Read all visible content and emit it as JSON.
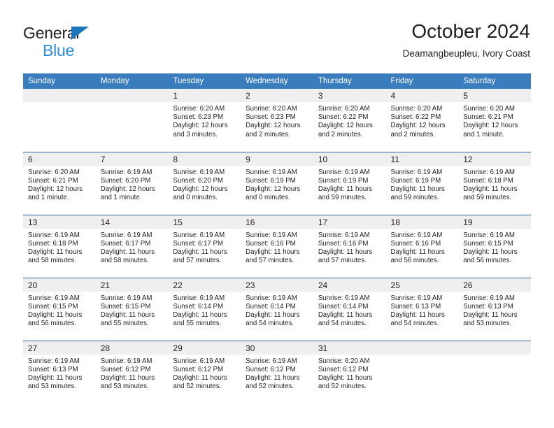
{
  "brand": {
    "name_part1": "General",
    "name_part2": "Blue",
    "colors": {
      "dark": "#231f20",
      "blue": "#2b8ede",
      "triangle": "#1b75bb"
    }
  },
  "header": {
    "title": "October 2024",
    "subtitle": "Deamangbeupleu, Ivory Coast"
  },
  "theme": {
    "header_bg": "#3a7dbf",
    "row_divider": "#2f6aa8",
    "daynum_bg": "#efefef",
    "text": "#231f20"
  },
  "weekdays": [
    "Sunday",
    "Monday",
    "Tuesday",
    "Wednesday",
    "Thursday",
    "Friday",
    "Saturday"
  ],
  "labels": {
    "sunrise": "Sunrise:",
    "sunset": "Sunset:",
    "daylight": "Daylight:"
  },
  "weeks": [
    [
      {
        "day": ""
      },
      {
        "day": ""
      },
      {
        "day": "1",
        "sunrise": "Sunrise: 6:20 AM",
        "sunset": "Sunset: 6:23 PM",
        "daylight_line1": "Daylight: 12 hours",
        "daylight_line2": "and 3 minutes."
      },
      {
        "day": "2",
        "sunrise": "Sunrise: 6:20 AM",
        "sunset": "Sunset: 6:23 PM",
        "daylight_line1": "Daylight: 12 hours",
        "daylight_line2": "and 2 minutes."
      },
      {
        "day": "3",
        "sunrise": "Sunrise: 6:20 AM",
        "sunset": "Sunset: 6:22 PM",
        "daylight_line1": "Daylight: 12 hours",
        "daylight_line2": "and 2 minutes."
      },
      {
        "day": "4",
        "sunrise": "Sunrise: 6:20 AM",
        "sunset": "Sunset: 6:22 PM",
        "daylight_line1": "Daylight: 12 hours",
        "daylight_line2": "and 2 minutes."
      },
      {
        "day": "5",
        "sunrise": "Sunrise: 6:20 AM",
        "sunset": "Sunset: 6:21 PM",
        "daylight_line1": "Daylight: 12 hours",
        "daylight_line2": "and 1 minute."
      }
    ],
    [
      {
        "day": "6",
        "sunrise": "Sunrise: 6:20 AM",
        "sunset": "Sunset: 6:21 PM",
        "daylight_line1": "Daylight: 12 hours",
        "daylight_line2": "and 1 minute."
      },
      {
        "day": "7",
        "sunrise": "Sunrise: 6:19 AM",
        "sunset": "Sunset: 6:20 PM",
        "daylight_line1": "Daylight: 12 hours",
        "daylight_line2": "and 1 minute."
      },
      {
        "day": "8",
        "sunrise": "Sunrise: 6:19 AM",
        "sunset": "Sunset: 6:20 PM",
        "daylight_line1": "Daylight: 12 hours",
        "daylight_line2": "and 0 minutes."
      },
      {
        "day": "9",
        "sunrise": "Sunrise: 6:19 AM",
        "sunset": "Sunset: 6:19 PM",
        "daylight_line1": "Daylight: 12 hours",
        "daylight_line2": "and 0 minutes."
      },
      {
        "day": "10",
        "sunrise": "Sunrise: 6:19 AM",
        "sunset": "Sunset: 6:19 PM",
        "daylight_line1": "Daylight: 11 hours",
        "daylight_line2": "and 59 minutes."
      },
      {
        "day": "11",
        "sunrise": "Sunrise: 6:19 AM",
        "sunset": "Sunset: 6:19 PM",
        "daylight_line1": "Daylight: 11 hours",
        "daylight_line2": "and 59 minutes."
      },
      {
        "day": "12",
        "sunrise": "Sunrise: 6:19 AM",
        "sunset": "Sunset: 6:18 PM",
        "daylight_line1": "Daylight: 11 hours",
        "daylight_line2": "and 59 minutes."
      }
    ],
    [
      {
        "day": "13",
        "sunrise": "Sunrise: 6:19 AM",
        "sunset": "Sunset: 6:18 PM",
        "daylight_line1": "Daylight: 11 hours",
        "daylight_line2": "and 58 minutes."
      },
      {
        "day": "14",
        "sunrise": "Sunrise: 6:19 AM",
        "sunset": "Sunset: 6:17 PM",
        "daylight_line1": "Daylight: 11 hours",
        "daylight_line2": "and 58 minutes."
      },
      {
        "day": "15",
        "sunrise": "Sunrise: 6:19 AM",
        "sunset": "Sunset: 6:17 PM",
        "daylight_line1": "Daylight: 11 hours",
        "daylight_line2": "and 57 minutes."
      },
      {
        "day": "16",
        "sunrise": "Sunrise: 6:19 AM",
        "sunset": "Sunset: 6:16 PM",
        "daylight_line1": "Daylight: 11 hours",
        "daylight_line2": "and 57 minutes."
      },
      {
        "day": "17",
        "sunrise": "Sunrise: 6:19 AM",
        "sunset": "Sunset: 6:16 PM",
        "daylight_line1": "Daylight: 11 hours",
        "daylight_line2": "and 57 minutes."
      },
      {
        "day": "18",
        "sunrise": "Sunrise: 6:19 AM",
        "sunset": "Sunset: 6:16 PM",
        "daylight_line1": "Daylight: 11 hours",
        "daylight_line2": "and 56 minutes."
      },
      {
        "day": "19",
        "sunrise": "Sunrise: 6:19 AM",
        "sunset": "Sunset: 6:15 PM",
        "daylight_line1": "Daylight: 11 hours",
        "daylight_line2": "and 56 minutes."
      }
    ],
    [
      {
        "day": "20",
        "sunrise": "Sunrise: 6:19 AM",
        "sunset": "Sunset: 6:15 PM",
        "daylight_line1": "Daylight: 11 hours",
        "daylight_line2": "and 56 minutes."
      },
      {
        "day": "21",
        "sunrise": "Sunrise: 6:19 AM",
        "sunset": "Sunset: 6:15 PM",
        "daylight_line1": "Daylight: 11 hours",
        "daylight_line2": "and 55 minutes."
      },
      {
        "day": "22",
        "sunrise": "Sunrise: 6:19 AM",
        "sunset": "Sunset: 6:14 PM",
        "daylight_line1": "Daylight: 11 hours",
        "daylight_line2": "and 55 minutes."
      },
      {
        "day": "23",
        "sunrise": "Sunrise: 6:19 AM",
        "sunset": "Sunset: 6:14 PM",
        "daylight_line1": "Daylight: 11 hours",
        "daylight_line2": "and 54 minutes."
      },
      {
        "day": "24",
        "sunrise": "Sunrise: 6:19 AM",
        "sunset": "Sunset: 6:14 PM",
        "daylight_line1": "Daylight: 11 hours",
        "daylight_line2": "and 54 minutes."
      },
      {
        "day": "25",
        "sunrise": "Sunrise: 6:19 AM",
        "sunset": "Sunset: 6:13 PM",
        "daylight_line1": "Daylight: 11 hours",
        "daylight_line2": "and 54 minutes."
      },
      {
        "day": "26",
        "sunrise": "Sunrise: 6:19 AM",
        "sunset": "Sunset: 6:13 PM",
        "daylight_line1": "Daylight: 11 hours",
        "daylight_line2": "and 53 minutes."
      }
    ],
    [
      {
        "day": "27",
        "sunrise": "Sunrise: 6:19 AM",
        "sunset": "Sunset: 6:13 PM",
        "daylight_line1": "Daylight: 11 hours",
        "daylight_line2": "and 53 minutes."
      },
      {
        "day": "28",
        "sunrise": "Sunrise: 6:19 AM",
        "sunset": "Sunset: 6:12 PM",
        "daylight_line1": "Daylight: 11 hours",
        "daylight_line2": "and 53 minutes."
      },
      {
        "day": "29",
        "sunrise": "Sunrise: 6:19 AM",
        "sunset": "Sunset: 6:12 PM",
        "daylight_line1": "Daylight: 11 hours",
        "daylight_line2": "and 52 minutes."
      },
      {
        "day": "30",
        "sunrise": "Sunrise: 6:19 AM",
        "sunset": "Sunset: 6:12 PM",
        "daylight_line1": "Daylight: 11 hours",
        "daylight_line2": "and 52 minutes."
      },
      {
        "day": "31",
        "sunrise": "Sunrise: 6:20 AM",
        "sunset": "Sunset: 6:12 PM",
        "daylight_line1": "Daylight: 11 hours",
        "daylight_line2": "and 52 minutes."
      },
      {
        "day": ""
      },
      {
        "day": ""
      }
    ]
  ]
}
